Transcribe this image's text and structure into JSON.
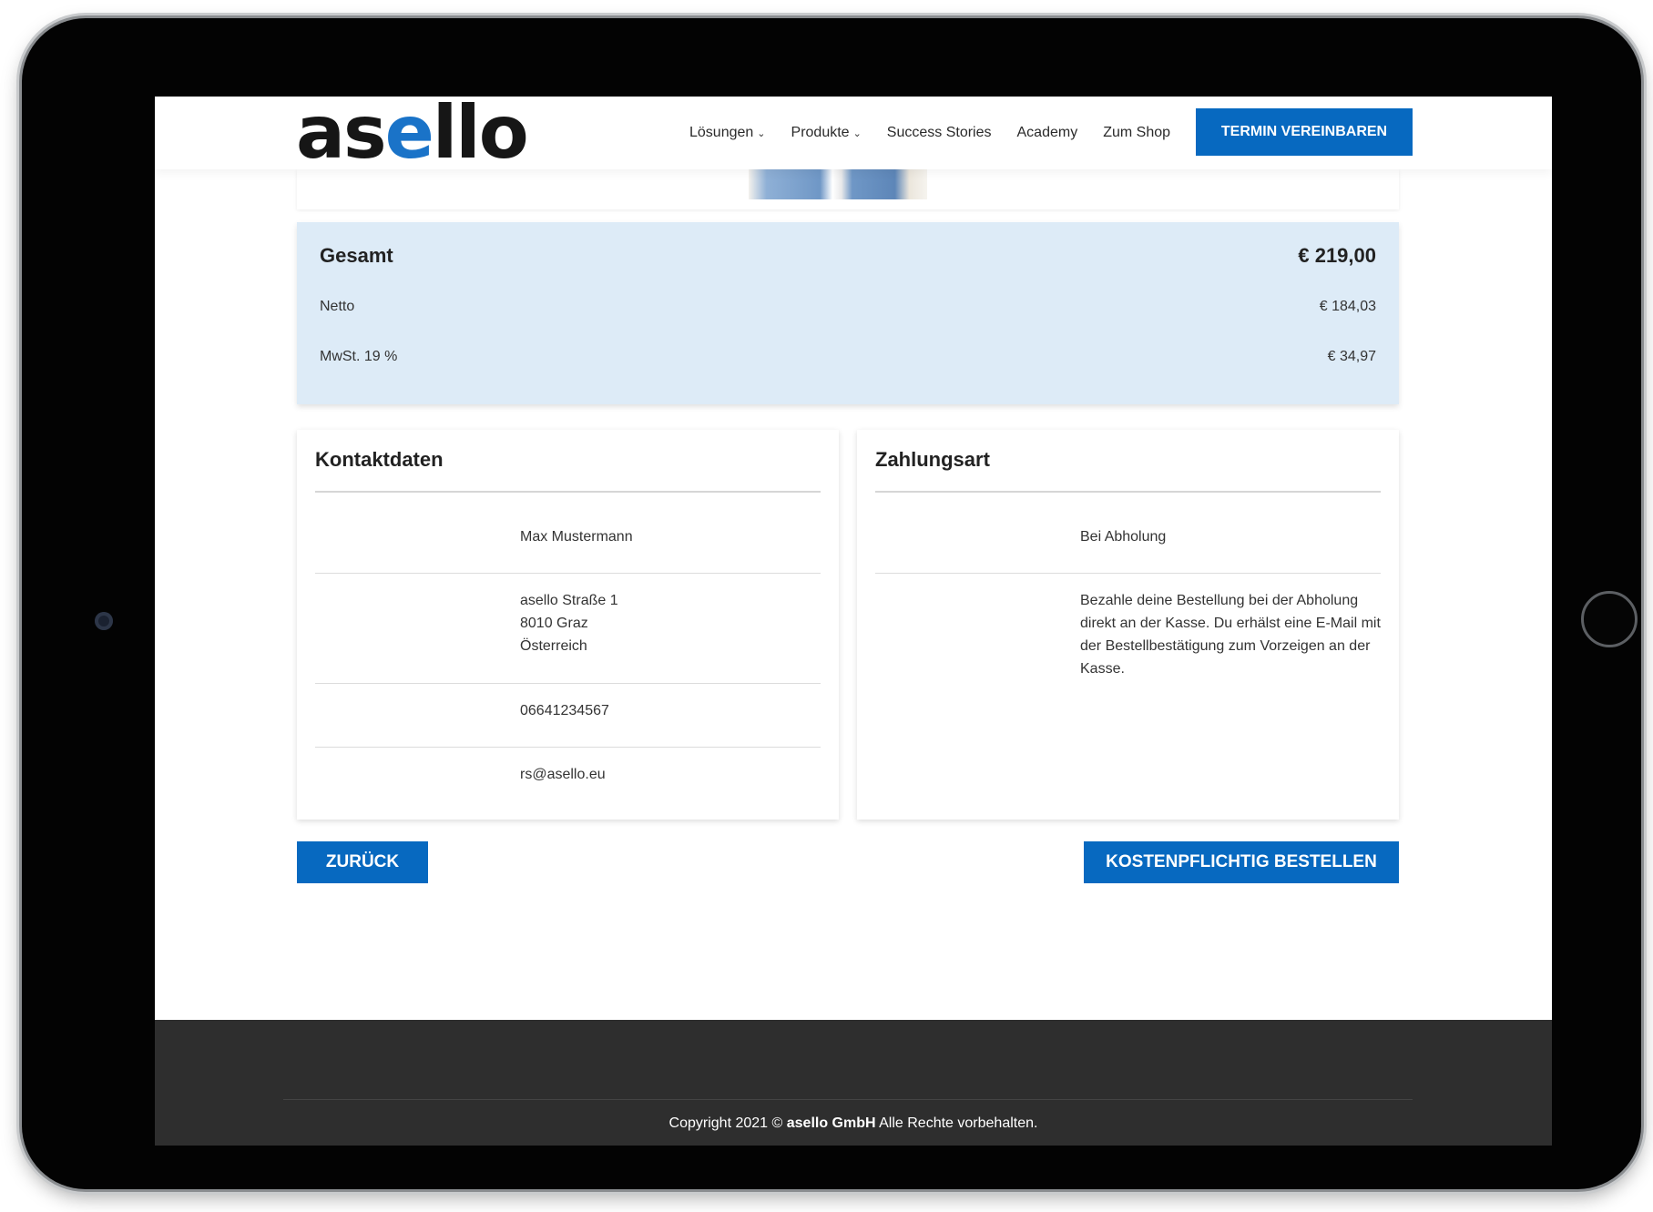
{
  "header": {
    "logo_prefix": "as",
    "logo_accent": "e",
    "logo_suffix": "llo",
    "nav": [
      {
        "label": "Lösungen",
        "dropdown": true
      },
      {
        "label": "Produkte",
        "dropdown": true
      },
      {
        "label": "Success Stories",
        "dropdown": false
      },
      {
        "label": "Academy",
        "dropdown": false
      },
      {
        "label": "Zum Shop",
        "dropdown": false
      }
    ],
    "cta_label": "TERMIN VEREINBAREN"
  },
  "totals": {
    "total_label": "Gesamt",
    "total_value": "€ 219,00",
    "net_label": "Netto",
    "net_value": "€ 184,03",
    "vat_label": "MwSt. 19 %",
    "vat_value": "€ 34,97"
  },
  "contact": {
    "title": "Kontaktdaten",
    "name": "Max Mustermann",
    "street": "asello Straße 1",
    "city": "8010 Graz",
    "country": "Österreich",
    "phone": "06641234567",
    "email": "rs@asello.eu"
  },
  "payment": {
    "title": "Zahlungsart",
    "method": "Bei Abholung",
    "description": "Bezahle deine Bestellung bei der Abholung direkt an der Kasse. Du erhälst eine E-Mail mit der Bestellbestätigung zum Vorzeigen an der Kasse."
  },
  "actions": {
    "back_label": "ZURÜCK",
    "order_label": "KOSTENPFLICHTIG BESTELLEN"
  },
  "footer": {
    "copyright_prefix": "Copyright 2021 © ",
    "company": "asello GmbH",
    "rights": "Alle Rechte vorbehalten."
  },
  "colors": {
    "brand": "#0769c0",
    "totals_bg": "#ddebf7",
    "footer_bg": "#2e2e2e"
  }
}
